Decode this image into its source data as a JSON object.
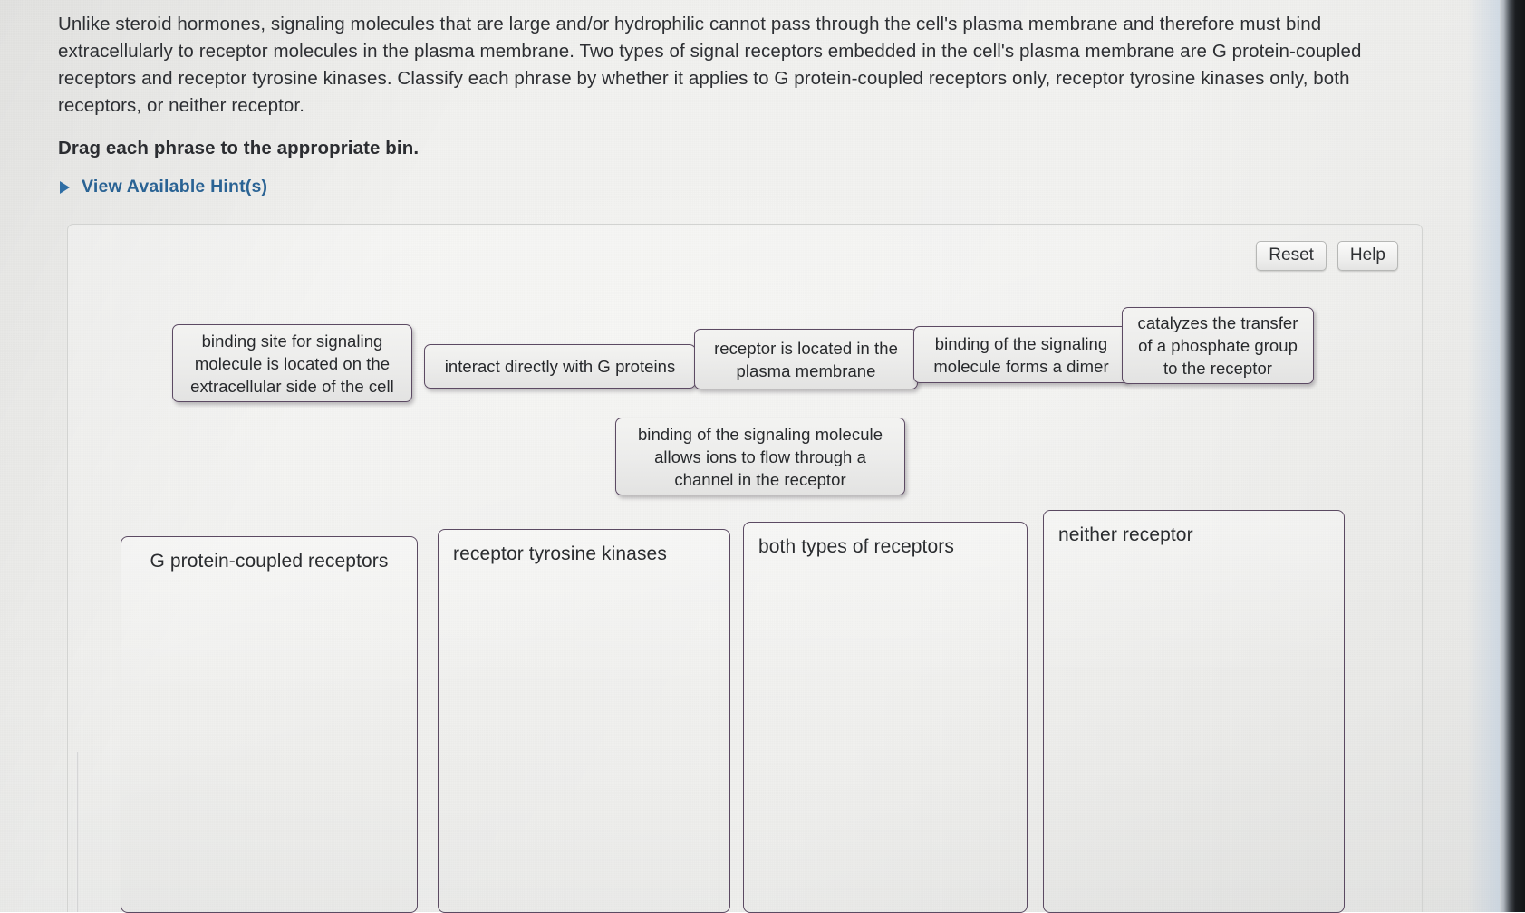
{
  "question": {
    "paragraph": "Unlike steroid hormones, signaling molecules that are large and/or hydrophilic cannot pass through the cell's plasma membrane and therefore must bind extracellularly to receptor molecules in the plasma membrane. Two types of signal receptors embedded in the cell's plasma membrane are G protein-coupled receptors and receptor tyrosine kinases. Classify each phrase by whether it applies to G protein-coupled receptors only, receptor tyrosine kinases only, both receptors, or neither receptor.",
    "instruction": "Drag each phrase to the appropriate bin."
  },
  "hints": {
    "label": "View Available Hint(s)",
    "icon": "triangle-right-icon",
    "color": "#2a6394"
  },
  "toolbar": {
    "reset_label": "Reset",
    "help_label": "Help"
  },
  "tiles": [
    {
      "text": "binding site for signaling molecule is located on the extracellular side of the cell"
    },
    {
      "text": "interact directly with G proteins"
    },
    {
      "text": "receptor is located in the plasma membrane"
    },
    {
      "text": "binding of the signaling molecule forms a dimer"
    },
    {
      "text": "catalyzes the transfer of a phosphate group to the receptor"
    },
    {
      "text": "binding of the signaling molecule allows ions to flow through a channel in the receptor"
    }
  ],
  "bins": [
    {
      "label": "G protein-coupled receptors",
      "align": "centered",
      "items": []
    },
    {
      "label": "receptor tyrosine kinases",
      "align": "left",
      "items": []
    },
    {
      "label": "both types of receptors",
      "align": "left",
      "items": []
    },
    {
      "label": "neither receptor",
      "align": "left",
      "items": []
    }
  ],
  "colors": {
    "tile_border": "#5c4a63",
    "bin_border": "#5b4a62",
    "link": "#2a6394",
    "text": "#2d2f33",
    "panel_bg": "#efefed"
  }
}
